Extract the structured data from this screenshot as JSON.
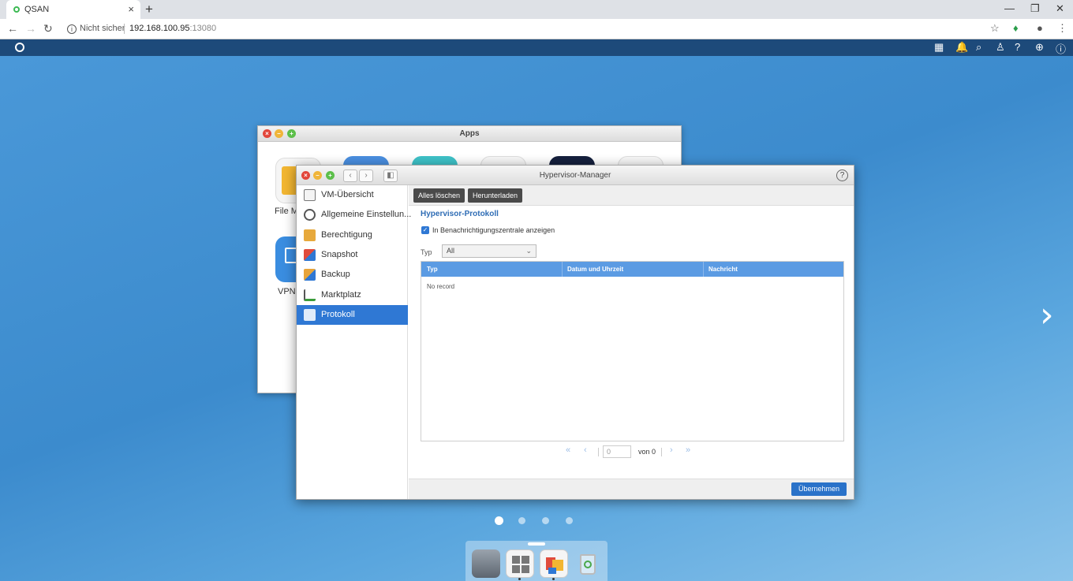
{
  "browser": {
    "tab_title": "QSAN",
    "tab_close": "×",
    "new_tab": "+",
    "not_secure": "Nicht sicher",
    "url_host": "192.168.100.95",
    "url_port": ":13080"
  },
  "apps_window": {
    "title": "Apps",
    "labels": [
      "File M",
      "VPN-"
    ]
  },
  "hypervisor": {
    "title": "Hypervisor-Manager",
    "help": "?",
    "sidebar": [
      {
        "label": "VM-Übersicht",
        "icon": "vm-overview-icon"
      },
      {
        "label": "Allgemeine Einstellun...",
        "icon": "settings-icon"
      },
      {
        "label": "Berechtigung",
        "icon": "permission-icon"
      },
      {
        "label": "Snapshot",
        "icon": "snapshot-icon"
      },
      {
        "label": "Backup",
        "icon": "backup-icon"
      },
      {
        "label": "Marktplatz",
        "icon": "marketplace-icon"
      },
      {
        "label": "Protokoll",
        "icon": "log-icon",
        "active": true
      }
    ],
    "toolbar": {
      "clear_all": "Alles löschen",
      "download": "Herunterladen"
    },
    "section_title": "Hypervisor-Protokoll",
    "checkbox_label": "In Benachrichtigungszentrale anzeigen",
    "checkbox_checked": true,
    "type_label": "Typ",
    "type_select": "All",
    "grid": {
      "columns": [
        "Typ",
        "Datum und Uhrzeit",
        "Nachricht"
      ],
      "empty_text": "No record"
    },
    "pager": {
      "page_value": "0",
      "of_text": "von 0"
    },
    "apply": "Übernehmen"
  },
  "desktop": {
    "page_dots": 4,
    "active_page": 1
  }
}
